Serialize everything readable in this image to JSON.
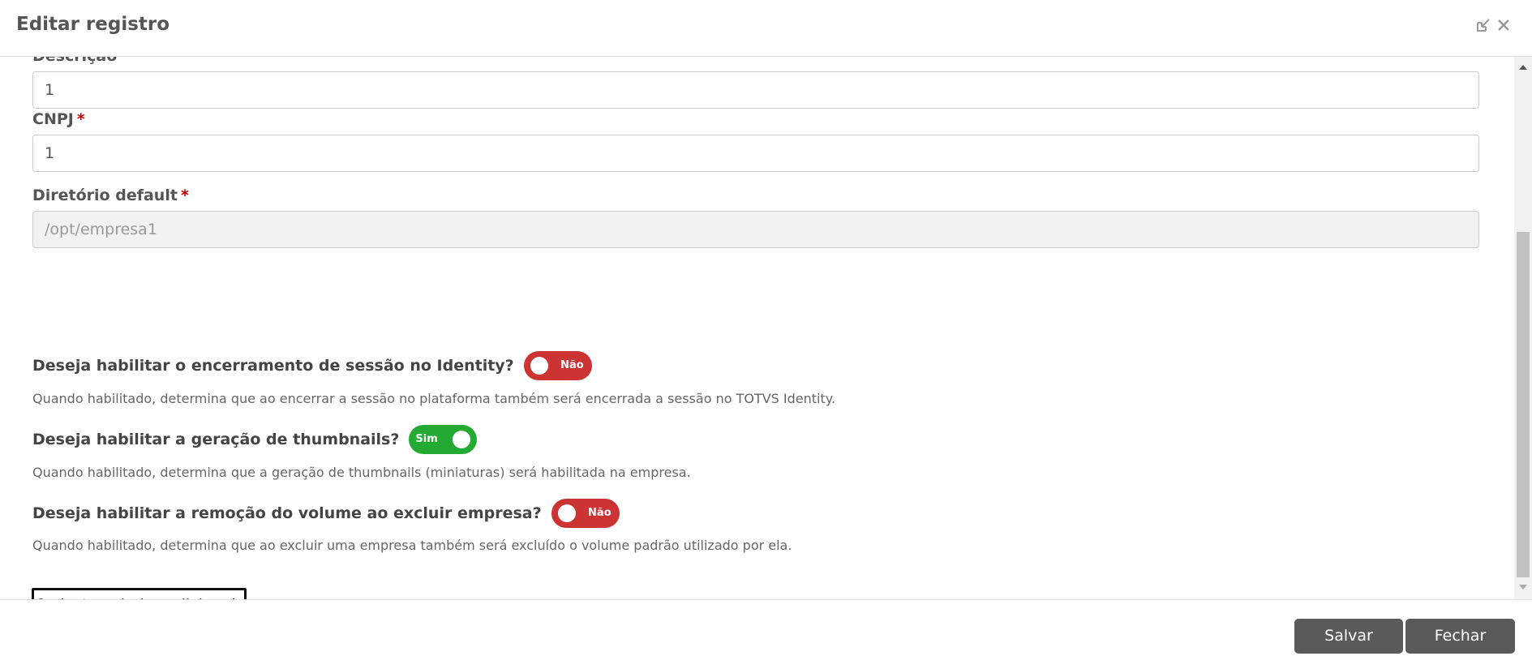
{
  "header": {
    "title": "Editar registro",
    "icons": [
      "minimize-icon",
      "close-icon"
    ]
  },
  "form": {
    "descricao": {
      "label": "Descrição",
      "value": "1"
    },
    "cnpj": {
      "label": "CNPJ",
      "value": "1"
    },
    "diretorio": {
      "label": "Diretório default",
      "value": "/opt/empresa1"
    },
    "required_mark": "*"
  },
  "toggles": [
    {
      "question": "Deseja habilitar o encerramento de sessão no Identity?",
      "state": "Não",
      "description": "Quando habilitado, determina que ao encerrar a sessão no plataforma também será encerrada a sessão no TOTVS Identity."
    },
    {
      "question": "Deseja habilitar a geração de thumbnails?",
      "state": "Sim",
      "description": "Quando habilitado, determina que a geração de thumbnails (miniaturas) será habilitada na empresa."
    },
    {
      "question": "Deseja habilitar a remoção do volume ao excluir empresa?",
      "state": "Não",
      "description": "Quando habilitado, determina que ao excluir uma empresa também será excluído o volume padrão utilizado por ela."
    }
  ],
  "extra_button": "Cadastrar dados adicionais",
  "footer": {
    "save_label": "Salvar",
    "close_label": "Fechar"
  },
  "colors": {
    "toggle_off": "#cc3333",
    "toggle_on": "#22aa33",
    "button_bg": "#5a5a5a"
  }
}
